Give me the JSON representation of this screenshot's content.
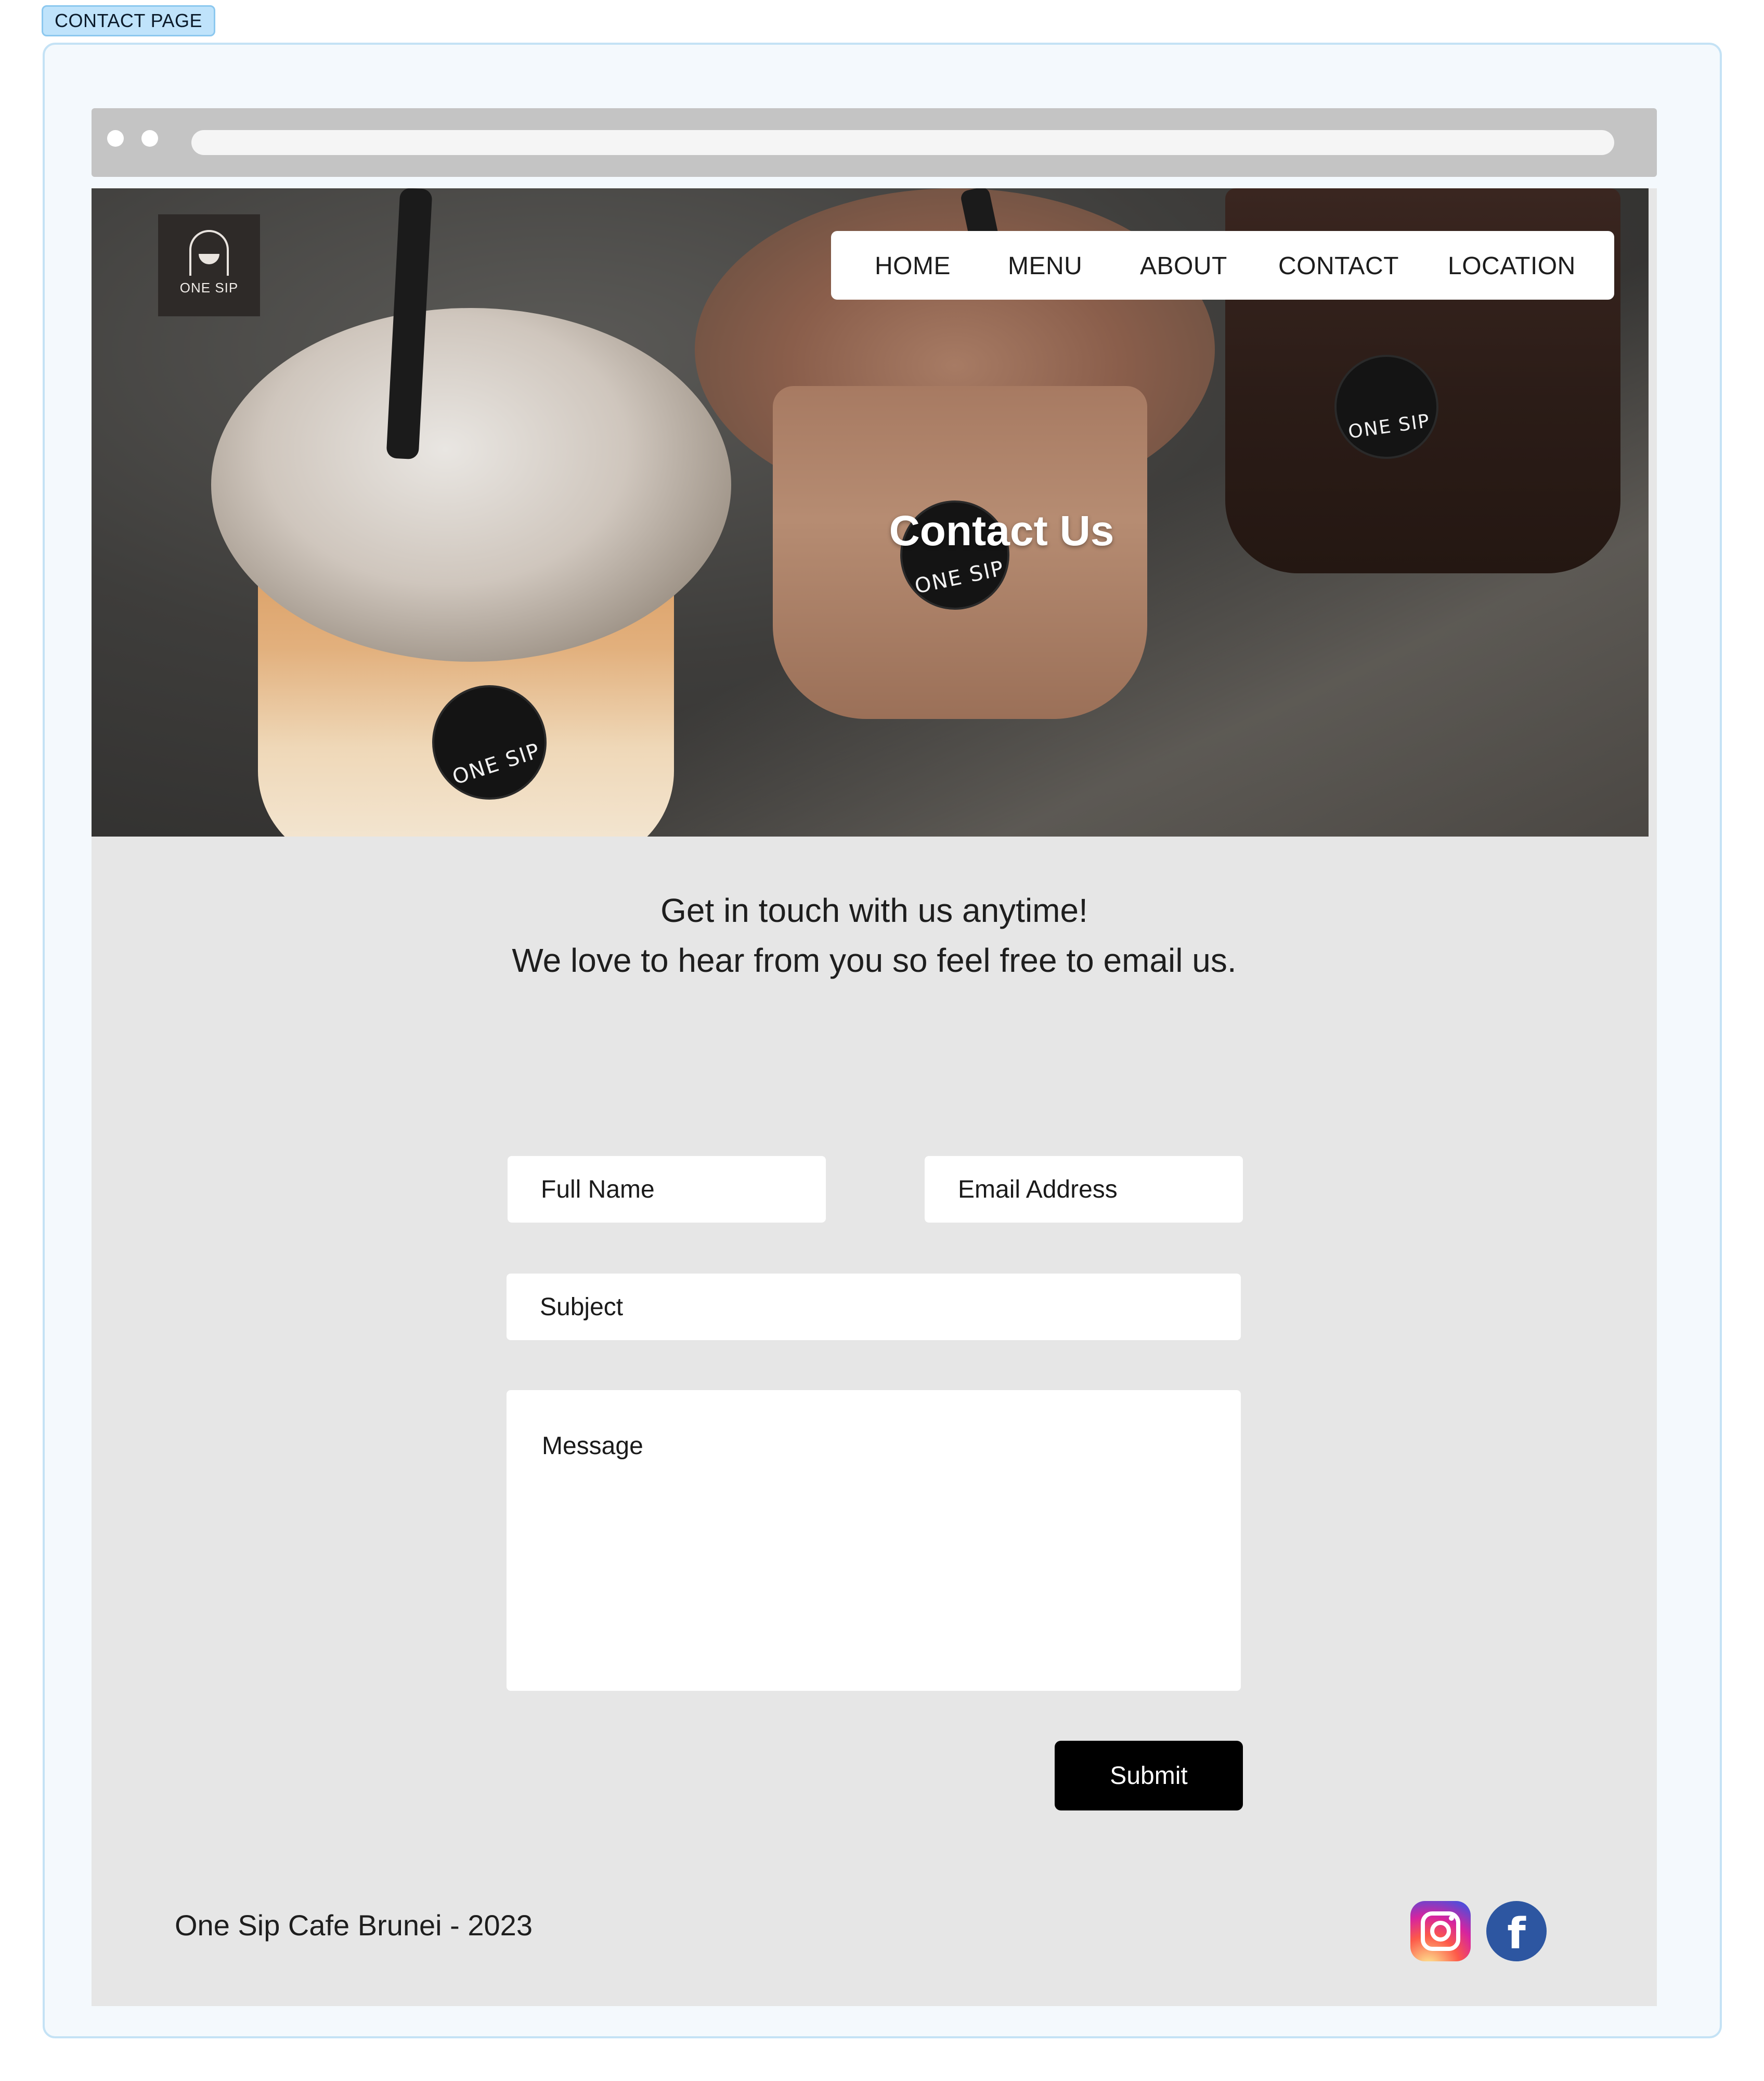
{
  "annotation": {
    "label": "CONTACT PAGE"
  },
  "brand": {
    "logo_text": "ONE SIP"
  },
  "nav": {
    "items": [
      {
        "label": "HOME"
      },
      {
        "label": "MENU"
      },
      {
        "label": "ABOUT"
      },
      {
        "label": "CONTACT"
      },
      {
        "label": "LOCATION"
      }
    ]
  },
  "hero": {
    "title": "Contact Us",
    "cup_sticker_text": "ONE SIP"
  },
  "intro": {
    "line1": "Get in touch with us anytime!",
    "line2": "We love to hear from you so feel free to email us."
  },
  "form": {
    "full_name_placeholder": "Full Name",
    "email_placeholder": "Email Address",
    "subject_placeholder": "Subject",
    "message_placeholder": "Message",
    "submit_label": "Submit"
  },
  "footer": {
    "text": "One Sip Cafe Brunei - 2023",
    "social": [
      {
        "icon": "instagram-icon"
      },
      {
        "icon": "facebook-icon",
        "glyph": "f"
      }
    ]
  },
  "colors": {
    "page_bg": "#e6e6e6",
    "frame_bg": "#f4f9fd",
    "frame_border": "#c4e2f5",
    "browser_bar": "#c4c4c4",
    "submit_bg": "#000000",
    "facebook_blue": "#2d56a1"
  }
}
